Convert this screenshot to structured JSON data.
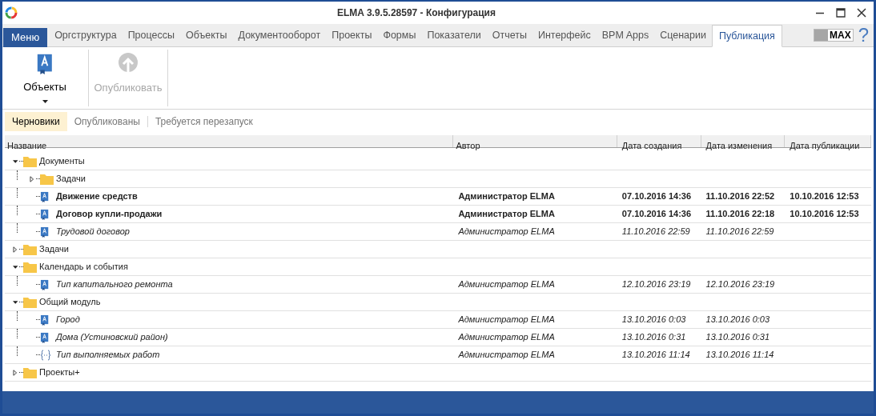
{
  "window": {
    "title": "ELMA 3.9.5.28597 - Конфигурация"
  },
  "menu_button": "Меню",
  "tabs": [
    {
      "label": "Оргструктура",
      "selected": false
    },
    {
      "label": "Процессы",
      "selected": false
    },
    {
      "label": "Объекты",
      "selected": false
    },
    {
      "label": "Документооборот",
      "selected": false
    },
    {
      "label": "Проекты",
      "selected": false
    },
    {
      "label": "Формы",
      "selected": false
    },
    {
      "label": "Показатели",
      "selected": false
    },
    {
      "label": "Отчеты",
      "selected": false
    },
    {
      "label": "Интерфейс",
      "selected": false
    },
    {
      "label": "BPM Apps",
      "selected": false
    },
    {
      "label": "Сценарии",
      "selected": false
    },
    {
      "label": "Публикация",
      "selected": true
    }
  ],
  "mode_toggle": {
    "label": "MAX"
  },
  "help": "?",
  "ribbon": [
    {
      "label": "Объекты",
      "kind": "objects",
      "disabled": false
    },
    {
      "label": "Опубликовать",
      "kind": "publish",
      "disabled": true
    }
  ],
  "subtabs": [
    {
      "label": "Черновики",
      "selected": true
    },
    {
      "label": "Опубликованы",
      "selected": false
    },
    {
      "label": "Требуется перезапуск",
      "selected": false
    }
  ],
  "table": {
    "columns": [
      "Название",
      "Автор",
      "Дата создания",
      "Дата изменения",
      "Дата публикации"
    ],
    "rows": [
      {
        "kind": "folder",
        "name": "Документы",
        "expanded": true,
        "children": [
          {
            "kind": "folder",
            "name": "Задачи",
            "expanded": false
          },
          {
            "kind": "object",
            "name": "Движение средств",
            "bold": true,
            "italic": false,
            "author": "Администратор ELMA",
            "created": "07.10.2016 14:36",
            "modified": "11.10.2016 22:52",
            "published": "10.10.2016 12:53"
          },
          {
            "kind": "object",
            "name": "Договор купли-продажи",
            "bold": true,
            "italic": false,
            "author": "Администратор ELMA",
            "created": "07.10.2016 14:36",
            "modified": "11.10.2016 22:18",
            "published": "10.10.2016 12:53"
          },
          {
            "kind": "object",
            "name": "Трудовой договор",
            "bold": false,
            "italic": true,
            "author": "Администратор ELMA",
            "created": "11.10.2016 22:59",
            "modified": "11.10.2016 22:59"
          }
        ]
      },
      {
        "kind": "folder",
        "name": "Задачи",
        "expanded": false
      },
      {
        "kind": "folder",
        "name": "Календарь и события",
        "expanded": true,
        "children": [
          {
            "kind": "object",
            "name": "Тип капитального ремонта",
            "bold": false,
            "italic": true,
            "author": "Администратор ELMA",
            "created": "12.10.2016 23:19",
            "modified": "12.10.2016 23:19"
          }
        ]
      },
      {
        "kind": "folder",
        "name": "Общий модуль",
        "expanded": true,
        "children": [
          {
            "kind": "object",
            "name": "Город",
            "bold": false,
            "italic": true,
            "author": "Администратор ELMA",
            "created": "13.10.2016 0:03",
            "modified": "13.10.2016 0:03"
          },
          {
            "kind": "object",
            "name": "Дома (Устиновский район)",
            "bold": false,
            "italic": true,
            "author": "Администратор ELMA",
            "created": "13.10.2016 0:31",
            "modified": "13.10.2016 0:31"
          },
          {
            "kind": "enum",
            "name": "Тип выполняемых работ",
            "bold": false,
            "italic": true,
            "author": "Администратор ELMA",
            "created": "13.10.2016 11:14",
            "modified": "13.10.2016 11:14"
          }
        ]
      },
      {
        "kind": "folder",
        "name": "Проекты+",
        "expanded": false
      }
    ]
  }
}
